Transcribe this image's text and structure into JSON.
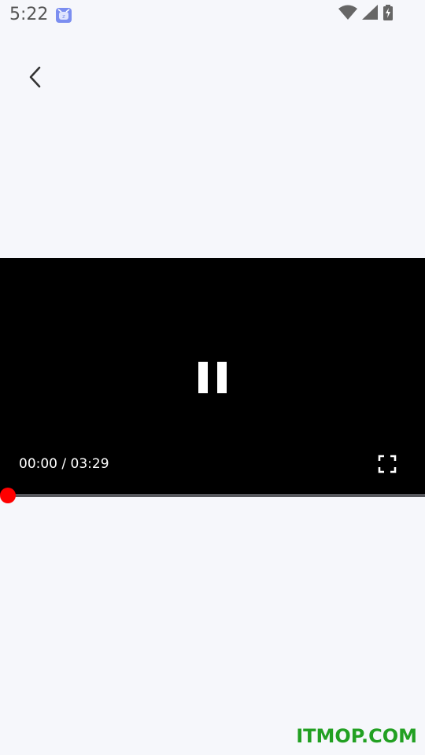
{
  "status_bar": {
    "time": "5:22",
    "notification_icon": "app-cat-icon",
    "icons": [
      "wifi-icon",
      "signal-icon",
      "battery-charging-icon"
    ]
  },
  "header": {
    "back_icon": "chevron-left-icon"
  },
  "player": {
    "state_icon": "pause-icon",
    "time_display": "00:00 / 03:29",
    "current_time": "00:00",
    "duration": "03:29",
    "progress_fraction": 0,
    "fullscreen_icon": "fullscreen-icon",
    "colors": {
      "progress": "#ff0000",
      "track": "#56575c",
      "background": "#000000"
    }
  },
  "watermark": {
    "text": "ITMOP.COM",
    "color": "#22a022"
  }
}
